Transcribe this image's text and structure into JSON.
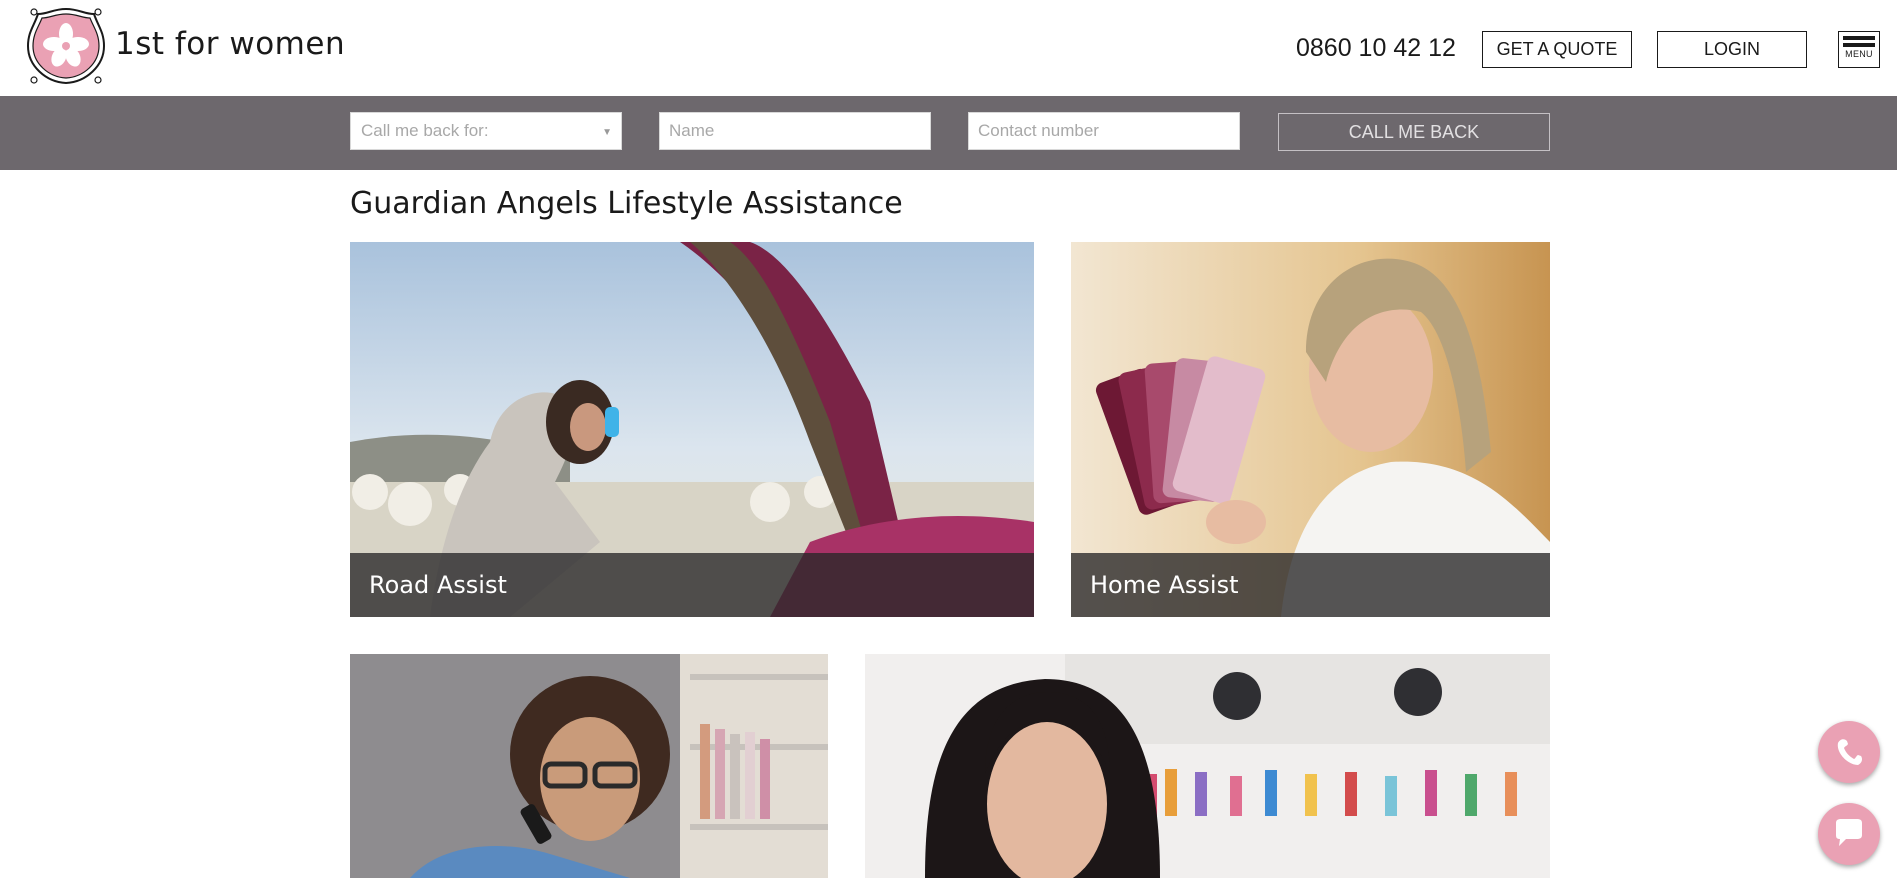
{
  "header": {
    "brand": "1st for women",
    "phone": "0860 10 42 12",
    "quote_label": "GET A QUOTE",
    "login_label": "LOGIN",
    "menu_label": "MENU"
  },
  "callback": {
    "select_placeholder": "Call me back for:",
    "name_placeholder": "Name",
    "contact_placeholder": "Contact number",
    "button_label": "CALL ME BACK"
  },
  "main": {
    "title": "Guardian Angels Lifestyle Assistance",
    "tiles": [
      {
        "label": "Road Assist"
      },
      {
        "label": "Home Assist"
      },
      {
        "label": ""
      },
      {
        "label": ""
      }
    ]
  },
  "colors": {
    "brand_pink": "#eaa1b4",
    "band_grey": "#6d686d",
    "label_overlay": "#282628"
  },
  "icons": {
    "logo": "flower-badge-icon",
    "call": "phone-icon",
    "chat": "chat-bubble-icon"
  }
}
